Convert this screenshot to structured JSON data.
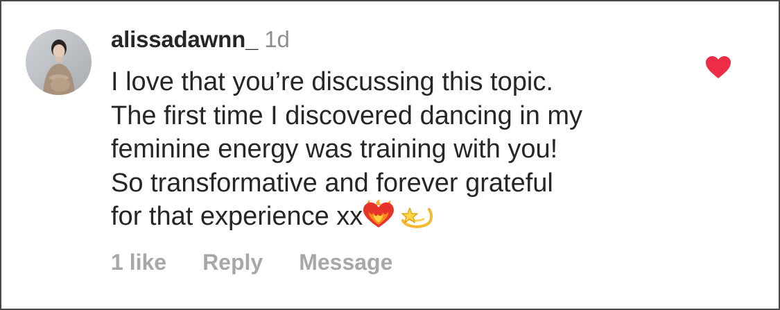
{
  "comment": {
    "username": "alissadawnn_",
    "timestamp": "1d",
    "avatar_icon": "profile-photo",
    "lines": [
      "I love that you’re discussing this topic.",
      "The first time I discovered dancing in my",
      "feminine energy was training with you!",
      "So transformative and forever grateful",
      "for that experience xx"
    ],
    "emojis": [
      "heart-on-fire-emoji",
      "dizzy-star-emoji"
    ],
    "liked": true,
    "like_icon": "heart-icon",
    "like_color": "#ed2d46",
    "actions": {
      "likes": "1 like",
      "reply": "Reply",
      "message": "Message"
    }
  }
}
